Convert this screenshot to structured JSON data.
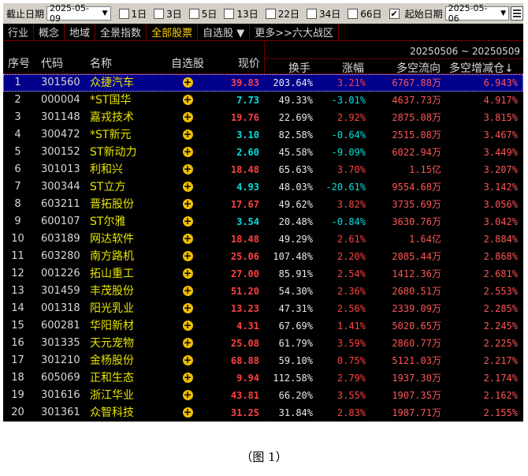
{
  "datebar": {
    "end_date_label": "截止日期",
    "end_date": "2025-05-09",
    "periods": [
      {
        "label": "1日",
        "checked": false
      },
      {
        "label": "3日",
        "checked": false
      },
      {
        "label": "5日",
        "checked": false
      },
      {
        "label": "13日",
        "checked": false
      },
      {
        "label": "22日",
        "checked": false
      },
      {
        "label": "34日",
        "checked": false
      },
      {
        "label": "66日",
        "checked": false
      },
      {
        "label": "",
        "checked": true
      }
    ],
    "start_date_label": "起始日期",
    "start_date": "2025-05-06",
    "check_mark": "✔"
  },
  "tabs": [
    "行业",
    "概念",
    "地域",
    "全景指数",
    "全部股票",
    "自选股 ▼",
    "更多>>六大战区"
  ],
  "active_tab": 4,
  "header": {
    "idx": "序号",
    "code": "代码",
    "name": "名称",
    "fav": "自选股",
    "price": "现价",
    "period": "20250506 ~ 20250509",
    "turnover": "换手",
    "change": "涨幅",
    "flow": "多空流向",
    "incr": "多空增减仓↓"
  },
  "rows": [
    {
      "idx": "1",
      "code": "301560",
      "name": "众捷汽车",
      "price": "39.83",
      "turnover": "203.64%",
      "change": "3.21%",
      "flow": "6767.88",
      "unit": "万",
      "incr": "6.943%"
    },
    {
      "idx": "2",
      "code": "000004",
      "name": "*ST国华",
      "price": "7.73",
      "turnover": "49.33%",
      "change": "-3.01%",
      "flow": "4637.73",
      "unit": "万",
      "incr": "4.917%"
    },
    {
      "idx": "3",
      "code": "301148",
      "name": "嘉戎技术",
      "price": "19.76",
      "turnover": "22.69%",
      "change": "2.92%",
      "flow": "2875.08",
      "unit": "万",
      "incr": "3.815%"
    },
    {
      "idx": "4",
      "code": "300472",
      "name": "*ST新元",
      "price": "3.10",
      "turnover": "82.58%",
      "change": "-0.64%",
      "flow": "2515.08",
      "unit": "万",
      "incr": "3.467%"
    },
    {
      "idx": "5",
      "code": "300152",
      "name": "ST新动力",
      "price": "2.60",
      "turnover": "45.58%",
      "change": "-9.09%",
      "flow": "6022.94",
      "unit": "万",
      "incr": "3.449%"
    },
    {
      "idx": "6",
      "code": "301013",
      "name": "利和兴",
      "price": "18.48",
      "turnover": "65.63%",
      "change": "3.70%",
      "flow": "1.15",
      "unit": "亿",
      "incr": "3.207%"
    },
    {
      "idx": "7",
      "code": "300344",
      "name": "ST立方",
      "price": "4.93",
      "turnover": "48.03%",
      "change": "-20.61%",
      "flow": "9554.68",
      "unit": "万",
      "incr": "3.142%"
    },
    {
      "idx": "8",
      "code": "603211",
      "name": "晋拓股份",
      "price": "17.67",
      "turnover": "49.62%",
      "change": "3.82%",
      "flow": "3735.69",
      "unit": "万",
      "incr": "3.056%"
    },
    {
      "idx": "9",
      "code": "600107",
      "name": "ST尔雅",
      "price": "3.54",
      "turnover": "20.48%",
      "change": "-0.84%",
      "flow": "3630.76",
      "unit": "万",
      "incr": "3.042%"
    },
    {
      "idx": "10",
      "code": "603189",
      "name": "网达软件",
      "price": "18.48",
      "turnover": "49.29%",
      "change": "2.61%",
      "flow": "1.64",
      "unit": "亿",
      "incr": "2.884%"
    },
    {
      "idx": "11",
      "code": "603280",
      "name": "南方路机",
      "price": "25.06",
      "turnover": "107.48%",
      "change": "2.20%",
      "flow": "2085.44",
      "unit": "万",
      "incr": "2.868%"
    },
    {
      "idx": "12",
      "code": "001226",
      "name": "拓山重工",
      "price": "27.00",
      "turnover": "85.91%",
      "change": "2.54%",
      "flow": "1412.36",
      "unit": "万",
      "incr": "2.681%"
    },
    {
      "idx": "13",
      "code": "301459",
      "name": "丰茂股份",
      "price": "51.20",
      "turnover": "54.30%",
      "change": "2.36%",
      "flow": "2680.51",
      "unit": "万",
      "incr": "2.553%"
    },
    {
      "idx": "14",
      "code": "001318",
      "name": "阳光乳业",
      "price": "13.23",
      "turnover": "47.31%",
      "change": "2.56%",
      "flow": "2339.09",
      "unit": "万",
      "incr": "2.285%"
    },
    {
      "idx": "15",
      "code": "600281",
      "name": "华阳新材",
      "price": "4.31",
      "turnover": "67.69%",
      "change": "1.41%",
      "flow": "5020.65",
      "unit": "万",
      "incr": "2.245%"
    },
    {
      "idx": "16",
      "code": "301335",
      "name": "天元宠物",
      "price": "25.08",
      "turnover": "61.79%",
      "change": "3.59%",
      "flow": "2860.77",
      "unit": "万",
      "incr": "2.225%"
    },
    {
      "idx": "17",
      "code": "301210",
      "name": "金杨股份",
      "price": "68.88",
      "turnover": "59.10%",
      "change": "0.75%",
      "flow": "5121.03",
      "unit": "万",
      "incr": "2.217%"
    },
    {
      "idx": "18",
      "code": "605069",
      "name": "正和生态",
      "price": "9.94",
      "turnover": "112.58%",
      "change": "2.79%",
      "flow": "1937.30",
      "unit": "万",
      "incr": "2.174%"
    },
    {
      "idx": "19",
      "code": "301616",
      "name": "浙江华业",
      "price": "43.81",
      "turnover": "66.20%",
      "change": "3.55%",
      "flow": "1907.35",
      "unit": "万",
      "incr": "2.162%"
    },
    {
      "idx": "20",
      "code": "301361",
      "name": "众智科技",
      "price": "31.25",
      "turnover": "31.84%",
      "change": "2.83%",
      "flow": "1987.71",
      "unit": "万",
      "incr": "2.155%"
    }
  ],
  "selected_row": 0,
  "colors": {
    "up": "#ff4040",
    "down": "#00e0e0",
    "name": "#e8e400",
    "selected_bg": "#00008b",
    "active_tab": "#ffd400",
    "separator": "#6a0000"
  },
  "icons": {
    "favorite": "plus-circle-icon",
    "calendar": "calendar-icon",
    "dropdown": "chevron-down-icon"
  },
  "caption": "（图 1）"
}
